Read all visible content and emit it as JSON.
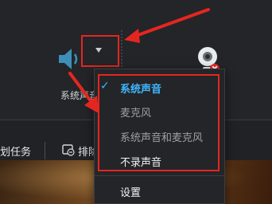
{
  "toolbar": {
    "system_sound_label": "系统声音",
    "speaker_icon": "speaker-icon",
    "dropdown_icon": "caret-down-icon",
    "webcam_icon": "webcam-icon"
  },
  "bottom_bar": {
    "plan_task_label": "划任务",
    "sort_label": "排除",
    "sort_icon": "sort-icon"
  },
  "audio_menu": {
    "items": [
      {
        "label": "系统声音",
        "selected": true
      },
      {
        "label": "麦克风",
        "selected": false
      },
      {
        "label": "系统声音和麦克风",
        "selected": false
      },
      {
        "label": "不录声音",
        "selected": false
      }
    ],
    "settings_label": "设置",
    "check_glyph": "✓"
  },
  "colors": {
    "accent_blue": "#3fb6ff",
    "annotation_red": "#e52620",
    "background": "#1f2124"
  }
}
